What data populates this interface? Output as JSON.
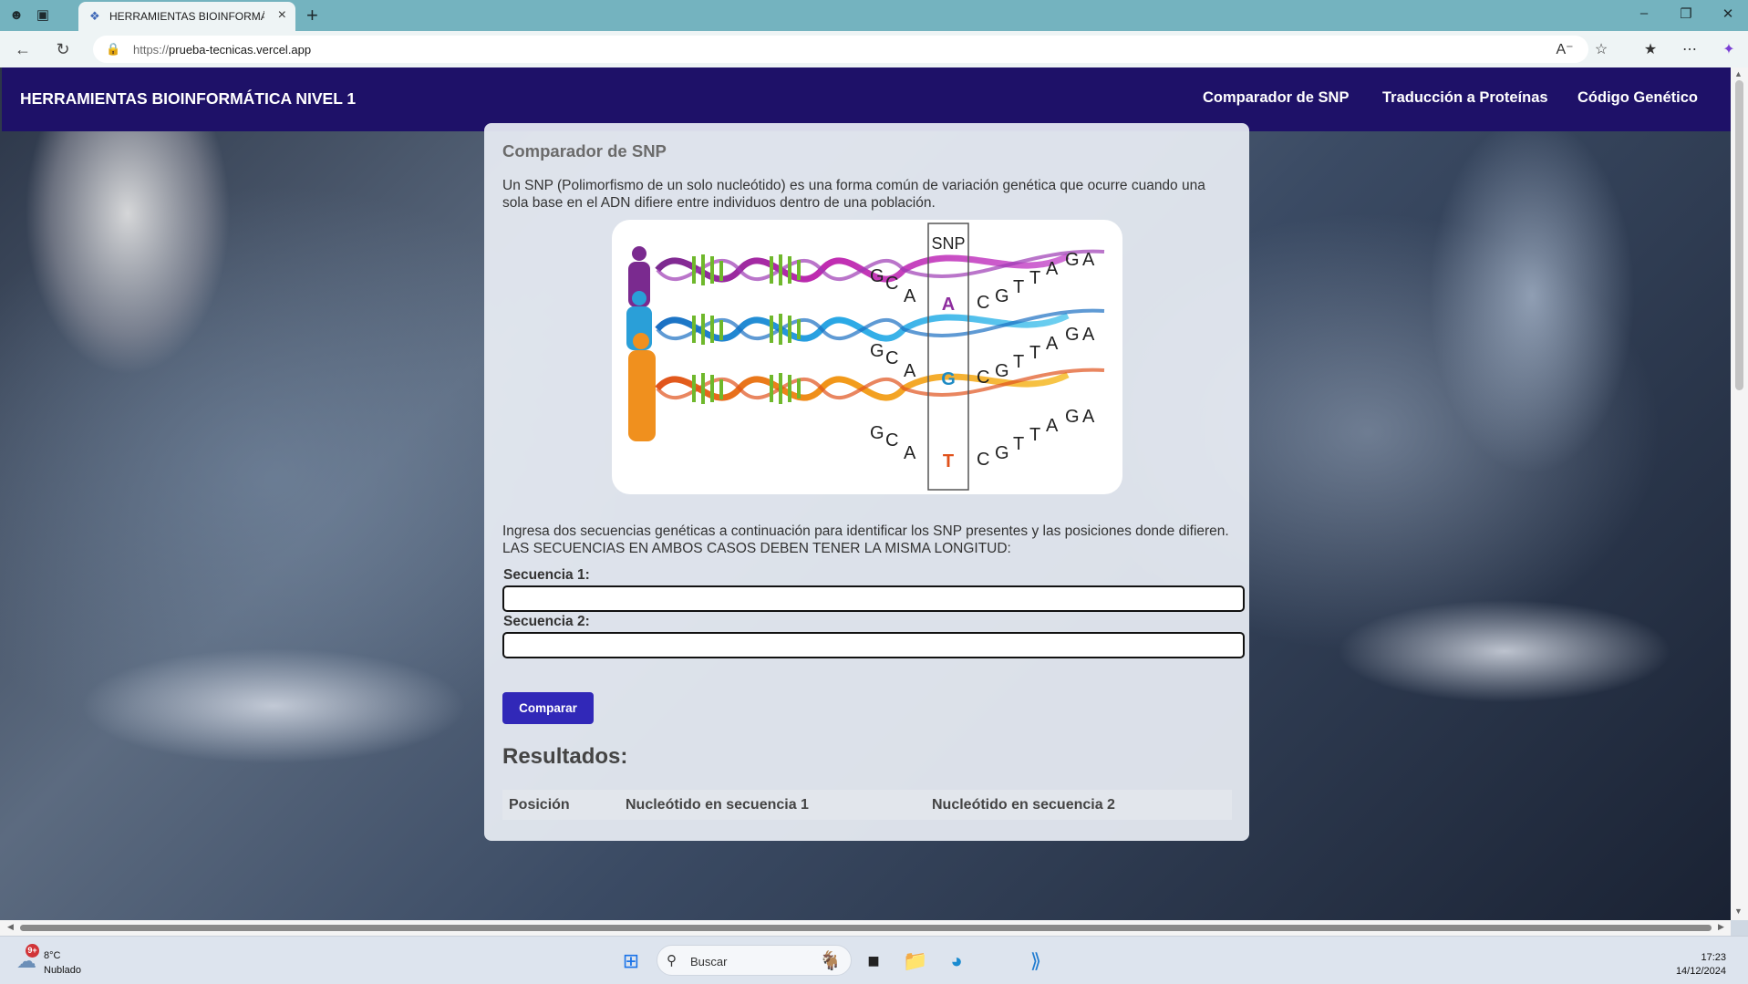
{
  "browser": {
    "tab_title": "HERRAMIENTAS BIOINFORMÁTIC",
    "url_scheme": "https://",
    "url_host": "prueba-tecnicas.vercel.app"
  },
  "header": {
    "brand": "HERRAMIENTAS BIOINFORMÁTICA NIVEL 1",
    "nav": [
      "Comparador de SNP",
      "Traducción a Proteínas",
      "Código Genético"
    ]
  },
  "main": {
    "title": "Comparador de SNP",
    "intro": "Un SNP (Polimorfismo de un solo nucleótido) es una forma común de variación genética que ocurre cuando una sola base en el ADN difiere entre individuos dentro de una población.",
    "instructions": "Ingresa dos secuencias genéticas a continuación para identificar los SNP presentes y las posiciones donde difieren. LAS SECUENCIAS EN AMBOS CASOS DEBEN TENER LA MISMA LONGITUD:",
    "seq1_label": "Secuencia 1:",
    "seq1_value": "",
    "seq2_label": "Secuencia 2:",
    "seq2_value": "",
    "compare_button": "Comparar",
    "results_title": "Resultados:",
    "results_columns": [
      "Posición",
      "Nucleótido en secuencia 1",
      "Nucleótido en secuencia 2"
    ]
  },
  "figure": {
    "snp_label": "SNP",
    "letters": [
      "G",
      "C",
      "A",
      "C",
      "G",
      "T",
      "T",
      "A",
      "G",
      "A"
    ],
    "variants": [
      {
        "base": "A",
        "color": "#8e2d9e"
      },
      {
        "base": "G",
        "color": "#1f8bc4"
      },
      {
        "base": "T",
        "color": "#e0521c"
      }
    ]
  },
  "taskbar": {
    "weather_badge": "9+",
    "temperature": "8°C",
    "condition": "Nublado",
    "search_placeholder": "Buscar",
    "time": "17:23",
    "date": "14/12/2024"
  }
}
